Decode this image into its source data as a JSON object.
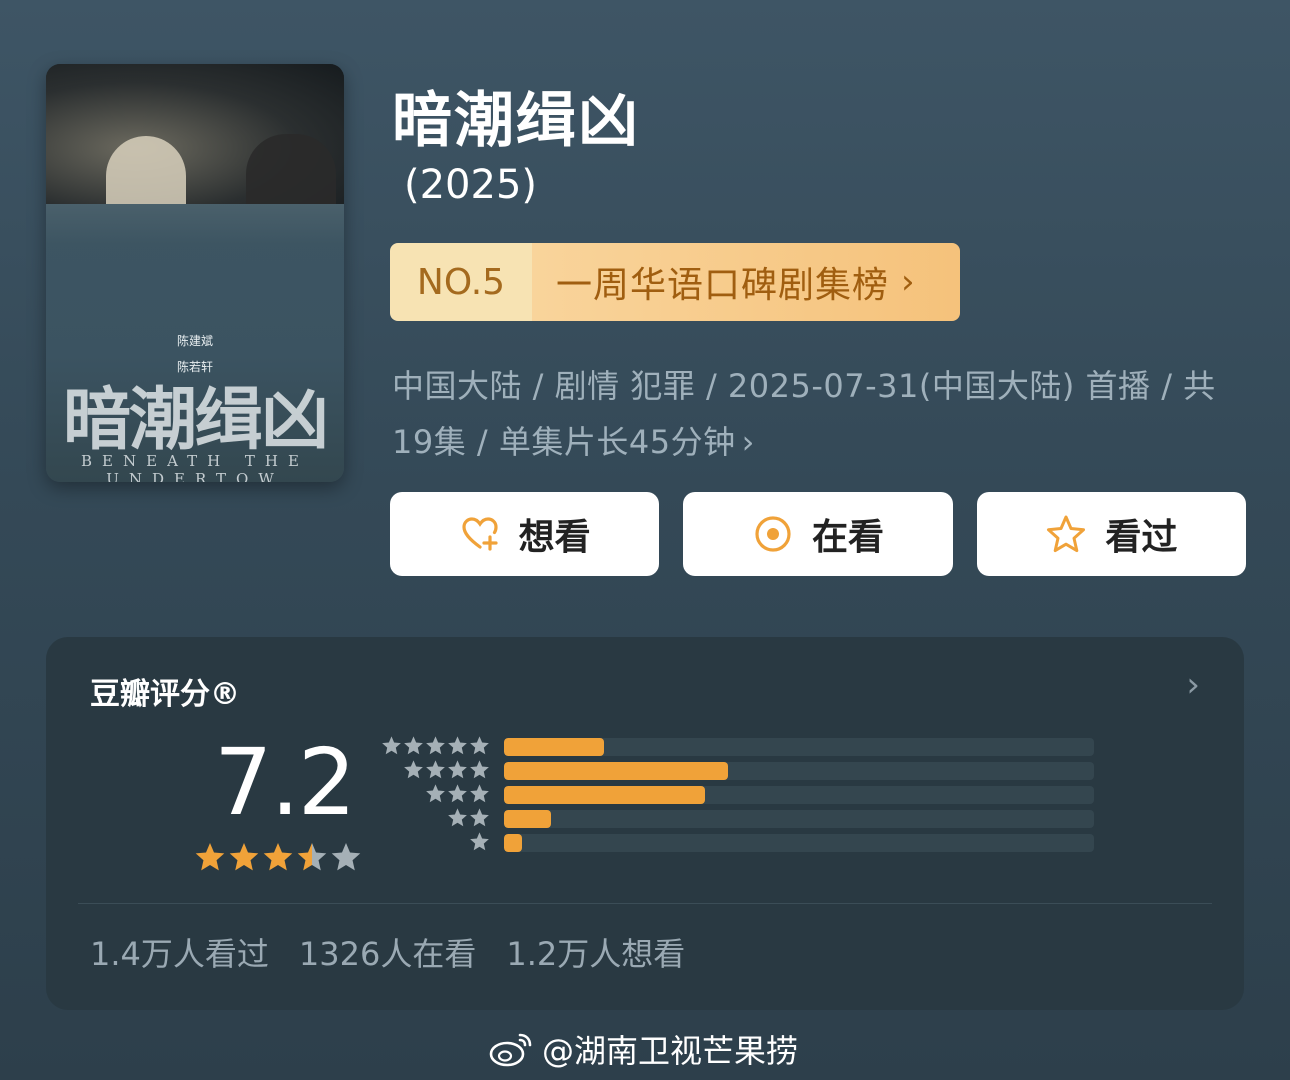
{
  "poster": {
    "cast_1": "陈建斌",
    "cast_2": "陈若轩",
    "title_art": "暗潮缉凶",
    "en_title": "BENEATH THE UNDERTOW"
  },
  "title": "暗潮缉凶",
  "year": "(2025)",
  "rank": {
    "no": "NO.5",
    "list": "一周华语口碑剧集榜",
    "chevron": "›"
  },
  "meta": {
    "line": "中国大陆 / 剧情 犯罪 / 2025-07-31(中国大陆) 首播 / 共19集 / 单集片长45分钟",
    "chevron": "›"
  },
  "actions": [
    {
      "label": "想看",
      "icon": "heart-plus-icon"
    },
    {
      "label": "在看",
      "icon": "target-icon"
    },
    {
      "label": "看过",
      "icon": "star-outline-icon"
    }
  ],
  "rating": {
    "title": "豆瓣评分®",
    "chevron": "›",
    "score": "7.2",
    "stars": 3.5,
    "distribution": [
      {
        "stars": 5,
        "fraction": 0.17
      },
      {
        "stars": 4,
        "fraction": 0.38
      },
      {
        "stars": 3,
        "fraction": 0.34
      },
      {
        "stars": 2,
        "fraction": 0.08
      },
      {
        "stars": 1,
        "fraction": 0.03
      }
    ],
    "colors": {
      "filled": "#f0a239",
      "empty": "#a5b0b6",
      "track": "#34464f"
    }
  },
  "stats": {
    "watched": "1.4万人看过",
    "watching": "1326人在看",
    "want": "1.2万人想看"
  },
  "watermark": {
    "text": "@湖南卫视芒果捞",
    "icon": "weibo-icon"
  }
}
